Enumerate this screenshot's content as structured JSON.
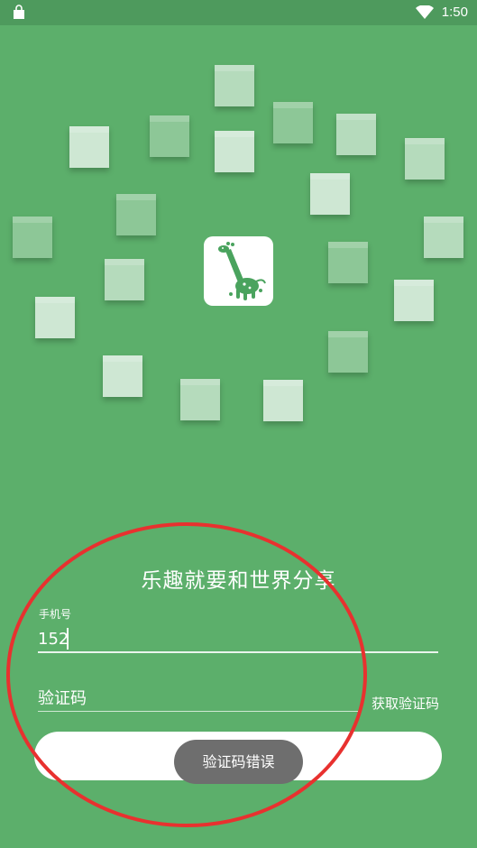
{
  "status_bar": {
    "time": "1:50",
    "left_icon": "shopping-bag-icon",
    "wifi_icon": "wifi-icon"
  },
  "hero": {
    "logo_icon": "giraffe-logo-icon",
    "slogan": "乐趣就要和世界分享"
  },
  "form": {
    "phone_label": "手机号",
    "phone_value": "152",
    "code_placeholder": "验证码",
    "get_code_label": "获取验证码",
    "submit_label": ""
  },
  "toast": {
    "message": "验证码错误"
  },
  "colors": {
    "background": "#5caf6b",
    "status_bar": "#4e9a5d",
    "toast": "#6e6e6e",
    "annotation_circle": "#e8312f"
  }
}
